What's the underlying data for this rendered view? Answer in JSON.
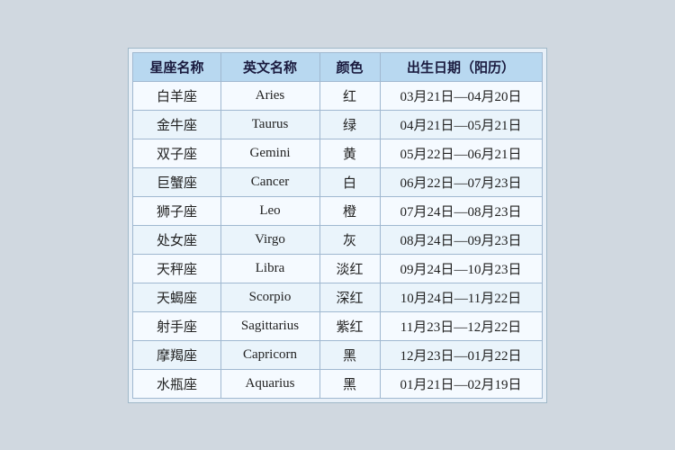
{
  "table": {
    "headers": [
      "星座名称",
      "英文名称",
      "颜色",
      "出生日期（阳历）"
    ],
    "rows": [
      {
        "zh": "白羊座",
        "en": "Aries",
        "color": "红",
        "date": "03月21日—04月20日"
      },
      {
        "zh": "金牛座",
        "en": "Taurus",
        "color": "绿",
        "date": "04月21日—05月21日"
      },
      {
        "zh": "双子座",
        "en": "Gemini",
        "color": "黄",
        "date": "05月22日—06月21日"
      },
      {
        "zh": "巨蟹座",
        "en": "Cancer",
        "color": "白",
        "date": "06月22日—07月23日"
      },
      {
        "zh": "狮子座",
        "en": "Leo",
        "color": "橙",
        "date": "07月24日—08月23日"
      },
      {
        "zh": "处女座",
        "en": "Virgo",
        "color": "灰",
        "date": "08月24日—09月23日"
      },
      {
        "zh": "天秤座",
        "en": "Libra",
        "color": "淡红",
        "date": "09月24日—10月23日"
      },
      {
        "zh": "天蝎座",
        "en": "Scorpio",
        "color": "深红",
        "date": "10月24日—11月22日"
      },
      {
        "zh": "射手座",
        "en": "Sagittarius",
        "color": "紫红",
        "date": "11月23日—12月22日"
      },
      {
        "zh": "摩羯座",
        "en": "Capricorn",
        "color": "黑",
        "date": "12月23日—01月22日"
      },
      {
        "zh": "水瓶座",
        "en": "Aquarius",
        "color": "黑",
        "date": "01月21日—02月19日"
      }
    ]
  }
}
